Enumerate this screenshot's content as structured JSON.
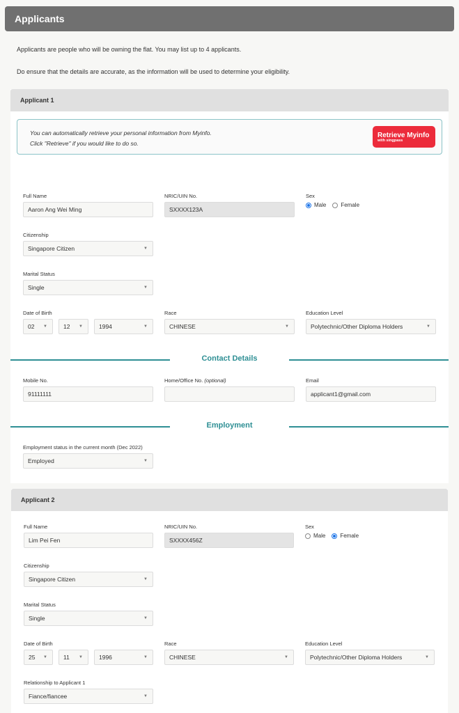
{
  "header": {
    "title": "Applicants"
  },
  "intro": {
    "line1": "Applicants are people who will be owning the flat. You may list up to 4 applicants.",
    "line2": "Do ensure that the details are accurate, as the information will be used to determine your eligibility."
  },
  "labels": {
    "full_name": "Full Name",
    "nric": "NRIC/UIN No.",
    "sex": "Sex",
    "male": "Male",
    "female": "Female",
    "citizenship": "Citizenship",
    "marital_status": "Marital Status",
    "dob": "Date of Birth",
    "race": "Race",
    "education": "Education Level",
    "mobile": "Mobile No.",
    "home_office": "Home/Office No.",
    "optional": "(optional)",
    "email": "Email",
    "employment_status": "Employment status in the current month (Dec 2022)",
    "relationship": "Relationship to Applicant 1"
  },
  "myinfo": {
    "line1": "You can automatically retrieve your personal information from Myinfo.",
    "line2": "Click \"Retrieve\" if you would like to do so.",
    "button_label": "Retrieve Myinfo",
    "button_sub": "with singpass",
    "button_color": "#ec2b3b"
  },
  "sections": {
    "contact": "Contact Details",
    "employment": "Employment"
  },
  "applicants": [
    {
      "title": "Applicant 1",
      "full_name": "Aaron Ang Wei Ming",
      "nric": "SXXXX123A",
      "sex": "Male",
      "citizenship": "Singapore Citizen",
      "marital_status": "Single",
      "dob_day": "02",
      "dob_month": "12",
      "dob_year": "1994",
      "race": "CHINESE",
      "education": "Polytechnic/Other Diploma Holders",
      "mobile": "91111111",
      "home_office": "",
      "email": "applicant1@gmail.com",
      "employment_status": "Employed"
    },
    {
      "title": "Applicant 2",
      "full_name": "Lim Pei Fen",
      "nric": "SXXXX456Z",
      "sex": "Female",
      "citizenship": "Singapore Citizen",
      "marital_status": "Single",
      "dob_day": "25",
      "dob_month": "11",
      "dob_year": "1996",
      "race": "CHINESE",
      "education": "Polytechnic/Other Diploma Holders",
      "relationship": "Fiance/fiancee"
    }
  ],
  "colors": {
    "accent": "#2e8f94",
    "header_bg": "#707070",
    "radio_checked": "#1a73e8"
  }
}
